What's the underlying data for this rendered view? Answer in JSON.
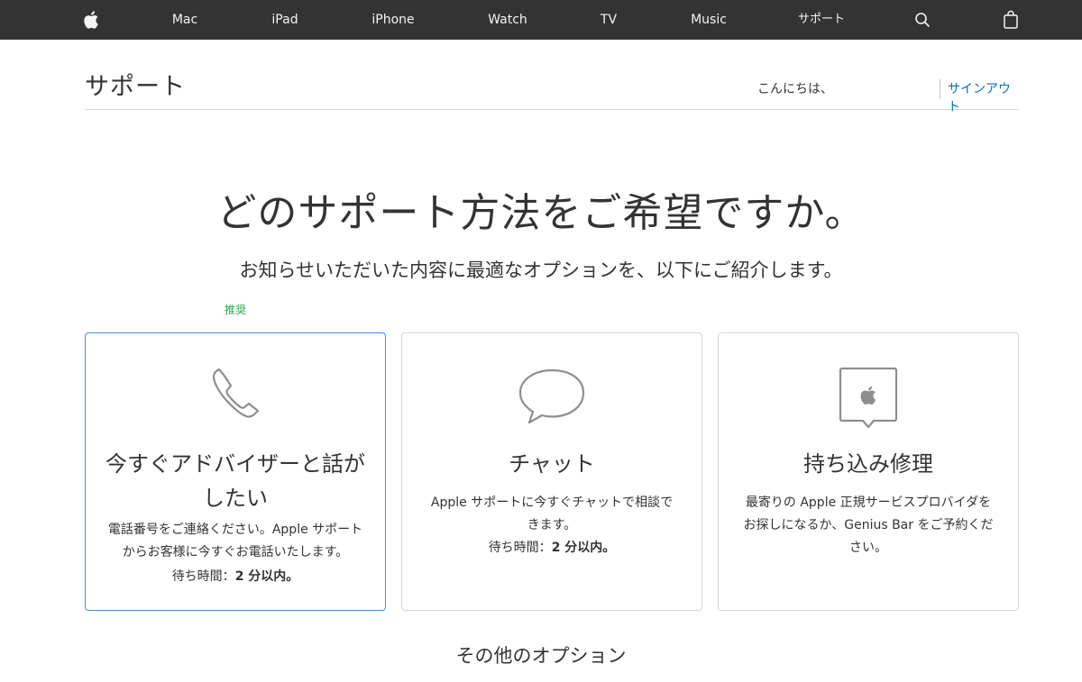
{
  "globalnav": {
    "items": [
      {
        "id": "mac",
        "label": "Mac"
      },
      {
        "id": "ipad",
        "label": "iPad"
      },
      {
        "id": "iphone",
        "label": "iPhone"
      },
      {
        "id": "watch",
        "label": "Watch"
      },
      {
        "id": "tv",
        "label": "TV"
      },
      {
        "id": "music",
        "label": "Music"
      },
      {
        "id": "support",
        "label": "サポート"
      }
    ],
    "icons": [
      "apple-logo-icon",
      "search-icon",
      "shopping-bag-icon"
    ]
  },
  "localnav": {
    "title": "サポート",
    "greeting": "こんにちは、",
    "signout": "サインアウト"
  },
  "hero": {
    "title": "どのサポート方法をご希望ですか。",
    "subtitle": "お知らせいただいた内容に最適なオプションを、以下にご紹介します。"
  },
  "recommended_label": "推奨",
  "cards": [
    {
      "id": "call",
      "icon": "phone-icon",
      "title": "今すぐアドバイザーと話がしたい",
      "desc": "電話番号をご連絡ください。Apple サポートからお客様に今すぐお電話いたします。",
      "wait_label": "待ち時間：",
      "wait_value": "2 分以内。",
      "selected": true
    },
    {
      "id": "chat",
      "icon": "chat-bubble-icon",
      "title": "チャット",
      "desc": "Apple サポートに今すぐチャットで相談できます。",
      "wait_label": "待ち時間：",
      "wait_value": "2 分以内。",
      "selected": false
    },
    {
      "id": "carry-in",
      "icon": "apple-store-pin-icon",
      "title": "持ち込み修理",
      "desc": "最寄りの Apple 正規サービスプロバイダをお探しになるか、Genius Bar をご予約ください。",
      "selected": false
    }
  ],
  "other_options": "その他のオプション",
  "colors": {
    "nav_bg": "#333333",
    "link": "#0070c9",
    "selected_border": "#3b8ff0",
    "recommended": "#2fa84f"
  }
}
